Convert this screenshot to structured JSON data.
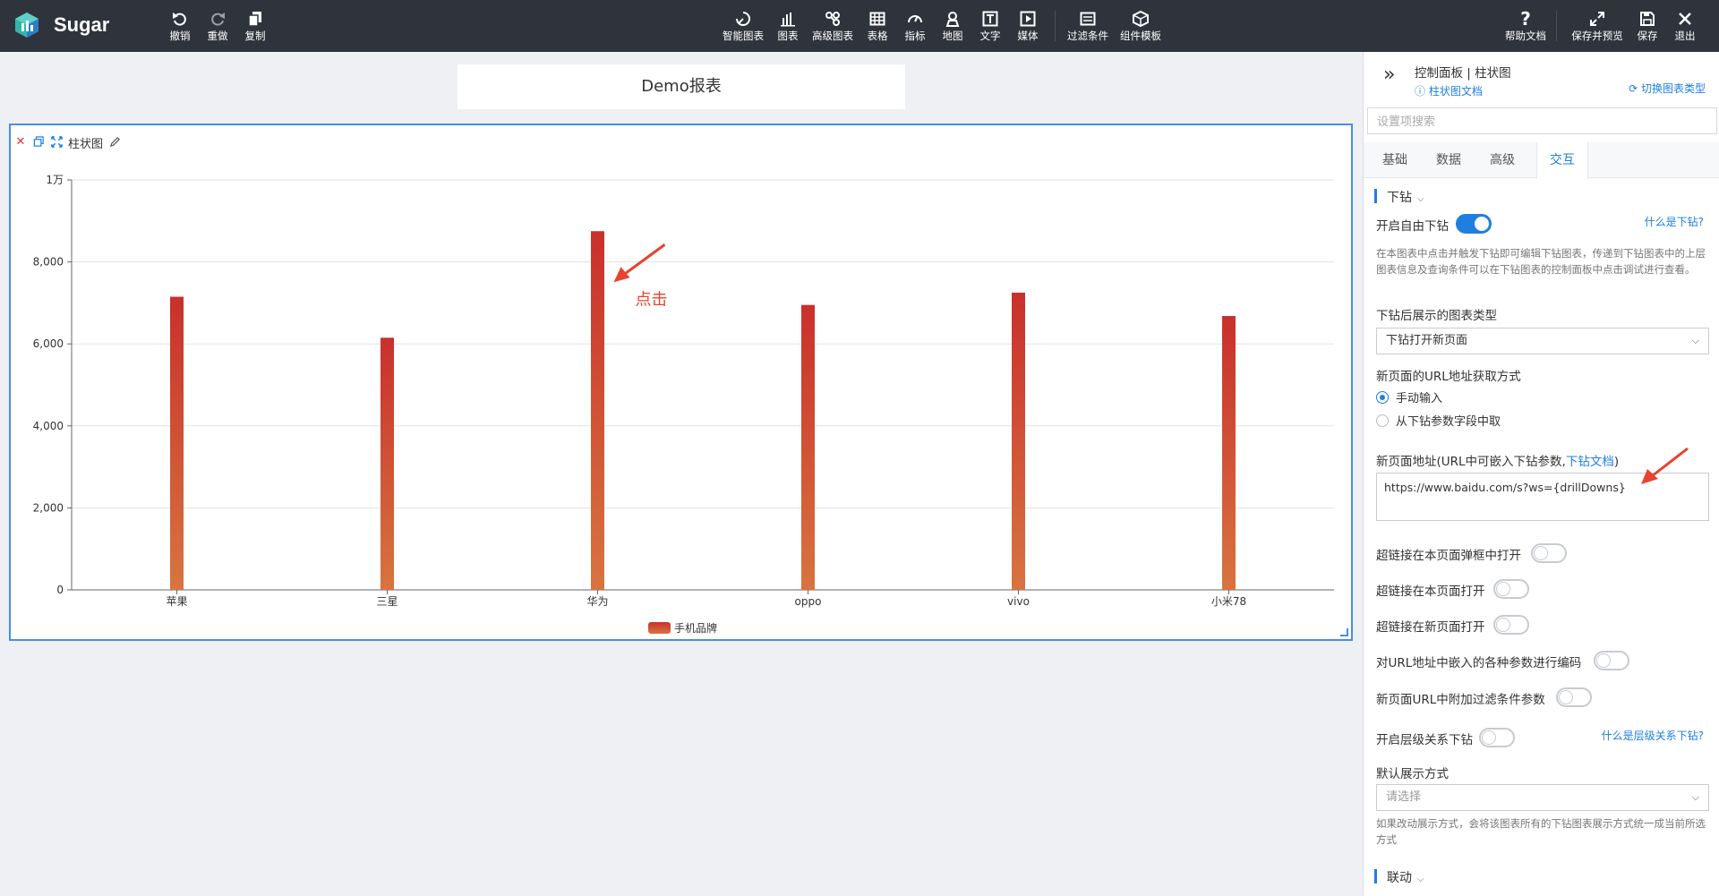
{
  "app": {
    "name": "Sugar"
  },
  "toolbar": {
    "left": [
      {
        "id": "undo",
        "label": "撤销",
        "icon": "undo-icon"
      },
      {
        "id": "redo",
        "label": "重做",
        "icon": "redo-icon"
      },
      {
        "id": "copy",
        "label": "复制",
        "icon": "copy-icon"
      }
    ],
    "center": [
      {
        "id": "smart-chart",
        "label": "智能图表",
        "icon": "smart-chart-icon"
      },
      {
        "id": "chart",
        "label": "图表",
        "icon": "bar-chart-icon"
      },
      {
        "id": "advanced-chart",
        "label": "高级图表",
        "icon": "advanced-chart-icon"
      },
      {
        "id": "table",
        "label": "表格",
        "icon": "table-icon"
      },
      {
        "id": "metric",
        "label": "指标",
        "icon": "gauge-icon"
      },
      {
        "id": "map",
        "label": "地图",
        "icon": "map-pin-icon"
      },
      {
        "id": "text",
        "label": "文字",
        "icon": "text-icon"
      },
      {
        "id": "media",
        "label": "媒体",
        "icon": "media-icon"
      },
      {
        "id": "filter",
        "label": "过滤条件",
        "icon": "filter-icon"
      },
      {
        "id": "template",
        "label": "组件模板",
        "icon": "template-icon"
      }
    ],
    "right": [
      {
        "id": "help",
        "label": "帮助文档",
        "icon": "help-icon"
      },
      {
        "id": "save-preview",
        "label": "保存并预览",
        "icon": "expand-icon"
      },
      {
        "id": "save",
        "label": "保存",
        "icon": "save-icon"
      },
      {
        "id": "exit",
        "label": "退出",
        "icon": "close-icon"
      }
    ]
  },
  "report": {
    "title": "Demo报表"
  },
  "chart_widget": {
    "name": "柱状图"
  },
  "chart_data": {
    "type": "bar",
    "categories": [
      "苹果",
      "三星",
      "华为",
      "oppo",
      "vivo",
      "小米78"
    ],
    "series": [
      {
        "name": "手机品牌",
        "values": [
          7150,
          6150,
          8750,
          6950,
          7250,
          6680
        ]
      }
    ],
    "ylim": [
      0,
      10000
    ],
    "yticks": [
      0,
      2000,
      4000,
      6000,
      8000,
      10000
    ],
    "ytick_labels": [
      "0",
      "2,000",
      "4,000",
      "6,000",
      "8,000",
      "1万"
    ],
    "grid": true,
    "legend": "bottom-center",
    "colors": {
      "top": "#c9302c",
      "bottom": "#d8743f"
    },
    "annotation": "点击"
  },
  "panel": {
    "title": "控制面板 | 柱状图",
    "doc_link": "柱状图文档",
    "switch_type": "切换图表类型",
    "search_placeholder": "设置项搜索",
    "tabs": [
      "基础",
      "数据",
      "高级",
      "交互"
    ],
    "active_tab": "交互",
    "drilldown": {
      "section": "下钻",
      "free_drill_label": "开启自由下钻",
      "free_drill_on": true,
      "what_is": "什么是下钻?",
      "desc": "在本图表中点击并触发下钻即可编辑下钻图表，传递到下钻图表中的上层图表信息及查询条件可以在下钻图表的控制面板中点击调试进行查看。",
      "chart_type_label": "下钻后展示的图表类型",
      "chart_type_value": "下钻打开新页面",
      "url_method_label": "新页面的URL地址获取方式",
      "url_methods": [
        "手动输入",
        "从下钻参数字段中取"
      ],
      "url_method_selected": 0,
      "url_label_prefix": "新页面地址(URL中可嵌入下钻参数,",
      "url_label_link": "下钻文档",
      "url_label_suffix": ")",
      "url_value": "https://www.baidu.com/s?ws={drillDowns}",
      "toggles": [
        {
          "label": "超链接在本页面弹框中打开",
          "on": false
        },
        {
          "label": "超链接在本页面打开",
          "on": false
        },
        {
          "label": "超链接在新页面打开",
          "on": false
        },
        {
          "label": "对URL地址中嵌入的各种参数进行编码",
          "on": false
        },
        {
          "label": "新页面URL中附加过滤条件参数",
          "on": false
        }
      ],
      "hierarchy_label": "开启层级关系下钻",
      "hierarchy_on": false,
      "hierarchy_help": "什么是层级关系下钻?",
      "default_display_label": "默认展示方式",
      "default_display_placeholder": "请选择",
      "default_display_desc": "如果改动展示方式，会将该图表所有的下钻图表展示方式统一成当前所选方式"
    },
    "linkage": {
      "section": "联动"
    }
  }
}
